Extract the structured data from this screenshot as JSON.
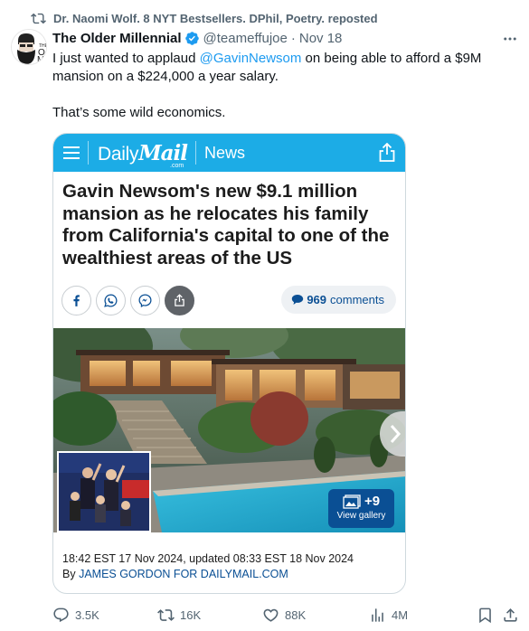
{
  "repost": {
    "label": "Dr. Naomi Wolf. 8 NYT Bestsellers. DPhil, Poetry. reposted",
    "icon": "repost-icon"
  },
  "post": {
    "author_name": "The Older Millennial",
    "handle": "@teameffujoe",
    "separator": "·",
    "date": "Nov 18",
    "text_part1": "I just wanted to applaud ",
    "mention": "@GavinNewsom",
    "text_part2": " on being able to afford a $9M mansion on a $224,000 a year salary.",
    "text_line2": "That’s some wild economics."
  },
  "card": {
    "brand_daily": "Daily",
    "brand_mail": "Mail",
    "brand_com": ".com",
    "section": "News",
    "headline": "Gavin Newsom's new $9.1 million mansion as he relocates his family from California's capital to one of the wealthiest areas of the US",
    "comments_count": "969",
    "comments_label": "comments",
    "gallery_count": "+9",
    "gallery_label": "View gallery",
    "timestamp": "18:42 EST 17 Nov 2024, updated 08:33 EST 18 Nov 2024",
    "byline_prefix": "By ",
    "byline_author": "JAMES GORDON FOR DAILYMAIL.COM",
    "bar_color": "#1cace6",
    "link_color": "#0a4f94"
  },
  "actions": {
    "replies": "3.5K",
    "reposts": "16K",
    "likes": "88K",
    "views": "4M"
  },
  "colors": {
    "accent": "#1d9bf0",
    "muted": "#536471"
  }
}
